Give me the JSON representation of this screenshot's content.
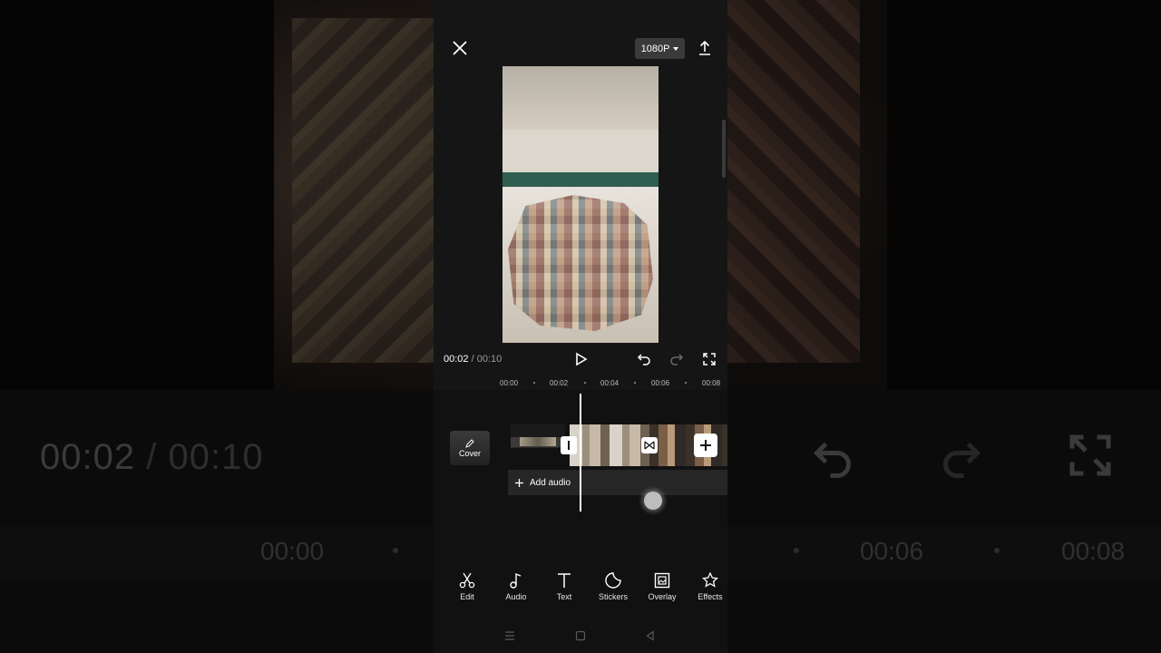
{
  "background": {
    "current_time": "00:02",
    "separator": "/",
    "total_time": "00:10",
    "ruler": [
      "00:00",
      "00:06",
      "00:08"
    ]
  },
  "header": {
    "resolution_label": "1080P"
  },
  "player": {
    "current_time": "00:02",
    "separator": "/",
    "total_time": "00:10"
  },
  "timeline": {
    "ruler": [
      "00:00",
      "00:02",
      "00:04",
      "00:06",
      "00:08"
    ],
    "cover_label": "Cover",
    "add_audio_label": "Add audio"
  },
  "toolbar": {
    "items": [
      {
        "label": "Edit",
        "icon": "scissors-icon"
      },
      {
        "label": "Audio",
        "icon": "music-note-icon"
      },
      {
        "label": "Text",
        "icon": "text-icon"
      },
      {
        "label": "Stickers",
        "icon": "sticker-icon"
      },
      {
        "label": "Overlay",
        "icon": "overlay-icon"
      },
      {
        "label": "Effects",
        "icon": "sparkle-star-icon"
      }
    ]
  },
  "nav": {
    "icons": [
      "menu-icon",
      "home-square-icon",
      "back-triangle-icon"
    ]
  },
  "colors": {
    "panel_bg": "#111111",
    "accent_white": "#ffffff",
    "stripe_green": "#2f5d4f"
  }
}
